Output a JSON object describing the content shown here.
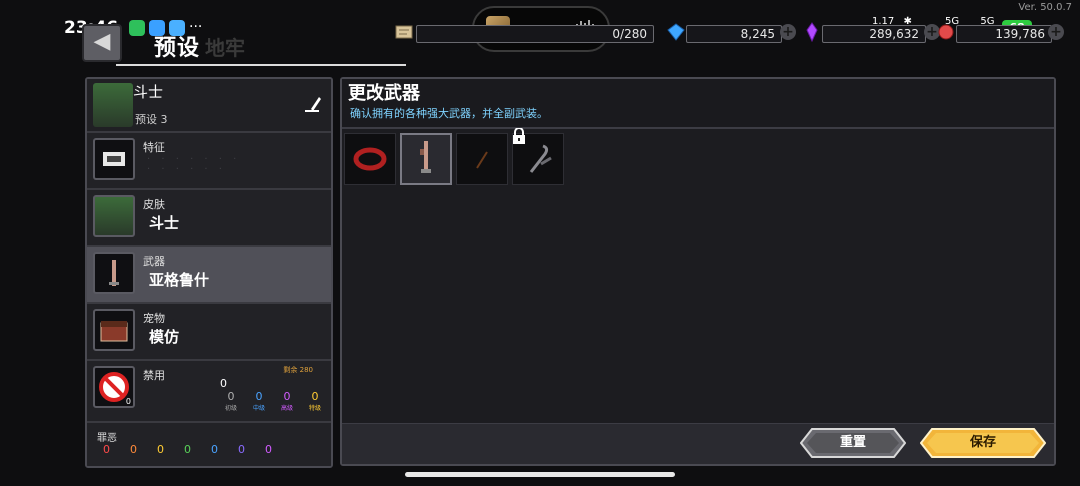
{
  "status_bar": {
    "time": "23:46",
    "version": "Ver. 50.0.7",
    "network_speed": "1.17",
    "signal_labels": [
      "5G",
      "5G"
    ],
    "battery": "68"
  },
  "header": {
    "title": "预设",
    "ghost_title": "地牢",
    "resources": [
      {
        "icon": "scroll-icon",
        "value": "0/280"
      },
      {
        "icon": "gem-icon",
        "value": "8,245"
      },
      {
        "icon": "crystal-icon",
        "value": "289,632"
      },
      {
        "icon": "coin-icon",
        "value": "139,786"
      }
    ]
  },
  "character": {
    "name": "斗士",
    "preset": "预设 3"
  },
  "rows": {
    "trait": {
      "label": "特征"
    },
    "skin": {
      "label": "皮肤",
      "value": "斗士"
    },
    "weapon": {
      "label": "武器",
      "value": "亚格鲁什"
    },
    "pet": {
      "label": "宠物",
      "value": "模仿"
    },
    "ban": {
      "label": "禁用",
      "count": "0",
      "icon_count": "0",
      "remaining": "剩余 280",
      "tiers": [
        {
          "value": "0",
          "name": "初级",
          "color": "#b0b0b0"
        },
        {
          "value": "0",
          "name": "中级",
          "color": "#4aa3ff"
        },
        {
          "value": "0",
          "name": "高级",
          "color": "#d25cff"
        },
        {
          "value": "0",
          "name": "特级",
          "color": "#ffcc33"
        }
      ]
    },
    "sin": {
      "label": "罪恶",
      "values": [
        "0",
        "0",
        "0",
        "0",
        "0",
        "0",
        "0"
      ],
      "colors": [
        "#ff4a4a",
        "#ff8a3a",
        "#ffcc33",
        "#58d058",
        "#4aa3ff",
        "#8a6cff",
        "#d25cff"
      ]
    }
  },
  "weapon_panel": {
    "title": "更改武器",
    "subtitle": "确认拥有的各种强大武器，并全副武装。",
    "items": [
      {
        "name": "ring-weapon",
        "selected": false,
        "locked": false
      },
      {
        "name": "aggrush-weapon",
        "selected": true,
        "locked": false
      },
      {
        "name": "dagger-weapon",
        "selected": false,
        "locked": false
      },
      {
        "name": "scythe-weapon",
        "selected": false,
        "locked": true
      }
    ],
    "reset_label": "重置",
    "save_label": "保存"
  }
}
